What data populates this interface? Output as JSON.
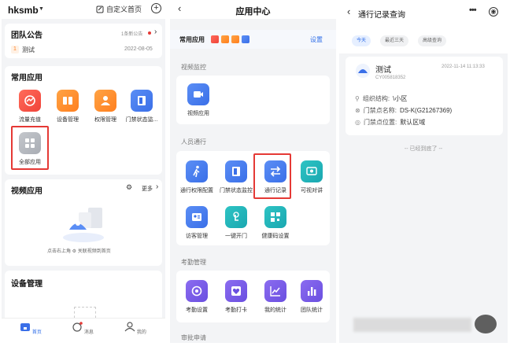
{
  "panel1": {
    "workspace": "hksmb",
    "custom_home": "自定义首页",
    "announce": {
      "title": "团队公告",
      "count_text": "1条新公告",
      "item_badge": "1",
      "item_text": "测试",
      "item_date": "2022-08-05"
    },
    "common_apps": {
      "title": "常用应用",
      "items": [
        {
          "label": "流量充值",
          "icon": "traffic-icon",
          "color": "#f0443a"
        },
        {
          "label": "设备管理",
          "icon": "device-icon",
          "color": "#ff8a2a"
        },
        {
          "label": "权限管理",
          "icon": "permission-icon",
          "color": "#ff8a2a"
        },
        {
          "label": "门禁状态监...",
          "icon": "door-icon",
          "color": "#3a6fe8"
        }
      ],
      "all_apps": "全部应用"
    },
    "video": {
      "title": "视频应用",
      "more": "更多",
      "hint": "点击右上角 ⚙ 关联视频到首页"
    },
    "device_mgmt": {
      "title": "设备管理"
    },
    "tabs": [
      {
        "label": "首页",
        "icon": "home-icon"
      },
      {
        "label": "消息",
        "icon": "message-icon"
      },
      {
        "label": "我的",
        "icon": "user-icon"
      }
    ]
  },
  "panel2": {
    "title": "应用中心",
    "common_label": "常用应用",
    "settings": "设置",
    "sections": [
      {
        "title": "视频监控",
        "apps": [
          {
            "label": "视频应用",
            "icon": "video-icon"
          }
        ]
      },
      {
        "title": "人员通行",
        "apps": [
          {
            "label": "通行权限配置",
            "icon": "walk-icon"
          },
          {
            "label": "门禁状态监控",
            "icon": "door-icon"
          },
          {
            "label": "通行记录",
            "icon": "transfer-icon"
          },
          {
            "label": "可视对讲",
            "icon": "intercom-icon"
          },
          {
            "label": "访客管理",
            "icon": "visitor-icon"
          },
          {
            "label": "一键开门",
            "icon": "tap-icon"
          },
          {
            "label": "健康码设置",
            "icon": "qrcode-icon"
          }
        ]
      },
      {
        "title": "考勤管理",
        "apps": [
          {
            "label": "考勤设置",
            "icon": "attendance-icon"
          },
          {
            "label": "考勤打卡",
            "icon": "heart-icon"
          },
          {
            "label": "我的统计",
            "icon": "chart-icon"
          },
          {
            "label": "团队统计",
            "icon": "bars-icon"
          }
        ]
      },
      {
        "title": "审批申请",
        "apps": []
      }
    ]
  },
  "panel3": {
    "title": "通行记录查询",
    "filters": [
      "今天",
      "最近三天",
      "高级查询"
    ],
    "record": {
      "name": "测试",
      "time": "2022-11-14 11:13:33",
      "code": "CY005818352",
      "org_key": "组织结构:",
      "org_val": "\\小区",
      "door_key": "门禁点名称:",
      "door_val": "DS-K(G21267369)",
      "loc_key": "门禁点位置:",
      "loc_val": "默认区域"
    },
    "end_text": "-- 已经到底了 --"
  }
}
